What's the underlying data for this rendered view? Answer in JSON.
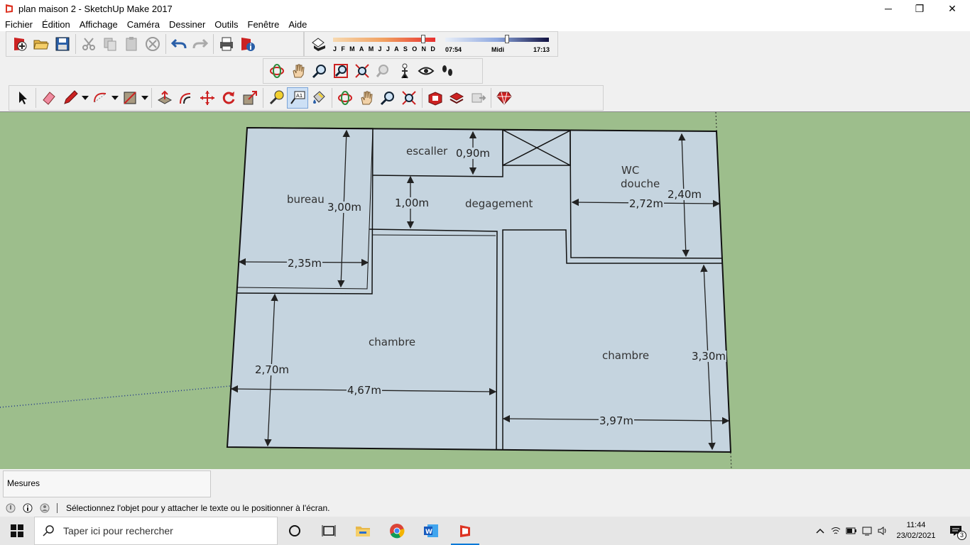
{
  "window": {
    "title": "plan maison 2 - SketchUp Make 2017",
    "minimize": "─",
    "maximize": "❐",
    "close": "✕"
  },
  "menu": [
    "Fichier",
    "Édition",
    "Affichage",
    "Caméra",
    "Dessiner",
    "Outils",
    "Fenêtre",
    "Aide"
  ],
  "shadow_settings": {
    "months": [
      "J",
      "F",
      "M",
      "A",
      "M",
      "J",
      "J",
      "A",
      "S",
      "O",
      "N",
      "D"
    ],
    "time_start": "07:54",
    "time_mid": "Midi",
    "time_end": "17:13"
  },
  "plan": {
    "rooms": [
      "escaller",
      "bureau",
      "degagement",
      "WC",
      "douche",
      "chambre",
      "chambre"
    ],
    "dimensions": [
      "0,90m",
      "3,00m",
      "1,00m",
      "2,35m",
      "2,72m",
      "2,40m",
      "2,70m",
      "4,67m",
      "3,97m",
      "3,30m"
    ]
  },
  "measures": {
    "label": "Mesures"
  },
  "status": {
    "message": "Sélectionnez l'objet pour y attacher le texte ou le positionner à l'écran."
  },
  "taskbar": {
    "search_placeholder": "Taper ici pour rechercher",
    "time": "11:44",
    "date": "23/02/2021",
    "notification_count": "3"
  },
  "colors": {
    "ground": "#9dbe8c",
    "floor": "#c5d4df",
    "accent": "#0078d7"
  }
}
